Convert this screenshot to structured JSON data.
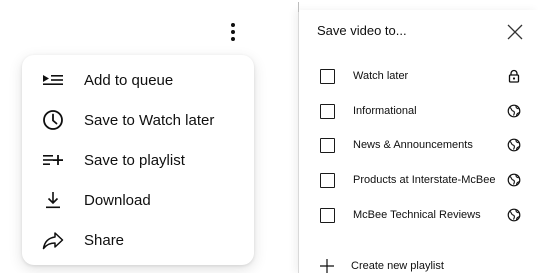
{
  "menu": {
    "items": [
      {
        "label": "Add to queue",
        "icon": "add-to-queue-icon"
      },
      {
        "label": "Save to Watch later",
        "icon": "clock-icon"
      },
      {
        "label": "Save to playlist",
        "icon": "playlist-add-icon"
      },
      {
        "label": "Download",
        "icon": "download-icon"
      },
      {
        "label": "Share",
        "icon": "share-icon"
      }
    ]
  },
  "save_dialog": {
    "title": "Save video to...",
    "playlists": [
      {
        "name": "Watch later",
        "checked": false,
        "privacy": "lock-icon"
      },
      {
        "name": "Informational",
        "checked": false,
        "privacy": "globe-icon"
      },
      {
        "name": "News & Announcements",
        "checked": false,
        "privacy": "globe-icon"
      },
      {
        "name": "Products at Interstate-McBee",
        "checked": false,
        "privacy": "globe-icon"
      },
      {
        "name": "McBee Technical Reviews",
        "checked": false,
        "privacy": "globe-icon"
      }
    ],
    "create_label": "Create new playlist"
  },
  "colors": {
    "text": "#0f0f0f",
    "icon": "#0f0f0f",
    "panel_border": "#d9d9d9"
  }
}
